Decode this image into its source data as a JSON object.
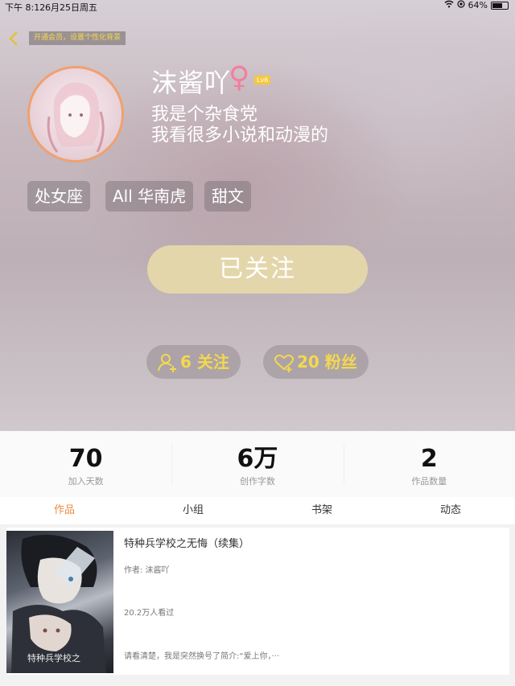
{
  "status_bar": {
    "time": "下午 8:12",
    "date": "6月25日周五",
    "battery": "64%"
  },
  "header": {
    "vip_hint": "开通会员，设置个性化背景"
  },
  "profile": {
    "nickname": "沫酱吖",
    "gender_symbol": "♀",
    "level": "Lv6",
    "bio_line1": "我是个杂食党",
    "bio_line2": "我看很多小说和动漫的",
    "tags": [
      "处女座",
      "All 华南虎",
      "甜文"
    ],
    "follow_button": "已关注",
    "following": "6 关注",
    "fans": "20 粉丝"
  },
  "stats": [
    {
      "value": "70",
      "label": "加入天数"
    },
    {
      "value": "6万",
      "label": "创作字数"
    },
    {
      "value": "2",
      "label": "作品数量"
    }
  ],
  "tabs": [
    "作品",
    "小组",
    "书架",
    "动态"
  ],
  "works": [
    {
      "title": "特种兵学校之无悔（续集）",
      "author": "作者: 沫酱吖",
      "reads": "20.2万人看过",
      "intro": "请看清楚，我是突然换号了简介:“爱上你，···",
      "cover_text": "特种兵学校之"
    }
  ],
  "colors": {
    "accent": "#f08a3c",
    "gold": "#f4d84e",
    "follow_btn": "#e3d6aa",
    "gender": "#f37e9d"
  }
}
